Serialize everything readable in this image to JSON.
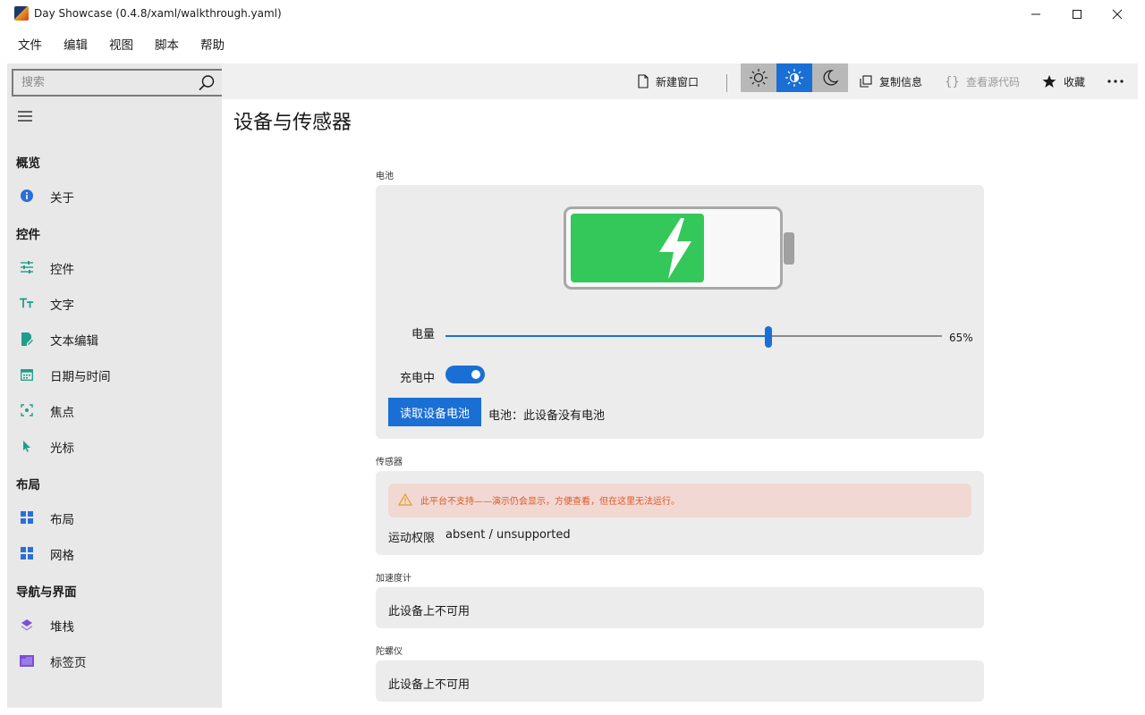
{
  "window": {
    "title": "Day Showcase (0.4.8/xaml/walkthrough.yaml)"
  },
  "menu": [
    "文件",
    "编辑",
    "视图",
    "脚本",
    "帮助"
  ],
  "sidebar": {
    "search_placeholder": "搜索",
    "sections": {
      "overview": "概览",
      "controls": "控件",
      "layout": "布局",
      "navigation": "导航与界面"
    },
    "items": {
      "about": "关于",
      "controls": "控件",
      "text": "文字",
      "text_edit": "文本编辑",
      "datetime": "日期与时间",
      "focus": "焦点",
      "cursor": "光标",
      "layout": "布局",
      "grid": "网格",
      "stack": "堆栈",
      "tabs": "标签页"
    }
  },
  "toolbar": {
    "new_window": "新建窗口",
    "copy_info": "复制信息",
    "view_source": "查看源代码",
    "favorite": "收藏",
    "theme_selected": "light"
  },
  "page": {
    "title": "设备与传感器"
  },
  "battery": {
    "section": "电池",
    "level_label": "电量",
    "level_percent": 65,
    "level_text": "65%",
    "charging_label": "充电中",
    "charging": true,
    "read_button": "读取设备电池",
    "status": "电池：此设备没有电池",
    "fill_color": "#34c759"
  },
  "sensors": {
    "section": "传感器",
    "warning": "此平台不支持——演示仍会显示，方便查看，但在这里无法运行。",
    "permission_label": "运动权限",
    "permission_value": "absent / unsupported"
  },
  "accelerometer": {
    "section": "加速度计",
    "status": "此设备上不可用"
  },
  "gyroscope": {
    "section": "陀螺仪",
    "status": "此设备上不可用"
  },
  "colors": {
    "accent": "#1a6fd4",
    "warning_bg": "#f2d8d2",
    "warning_text": "#d95a2b"
  }
}
